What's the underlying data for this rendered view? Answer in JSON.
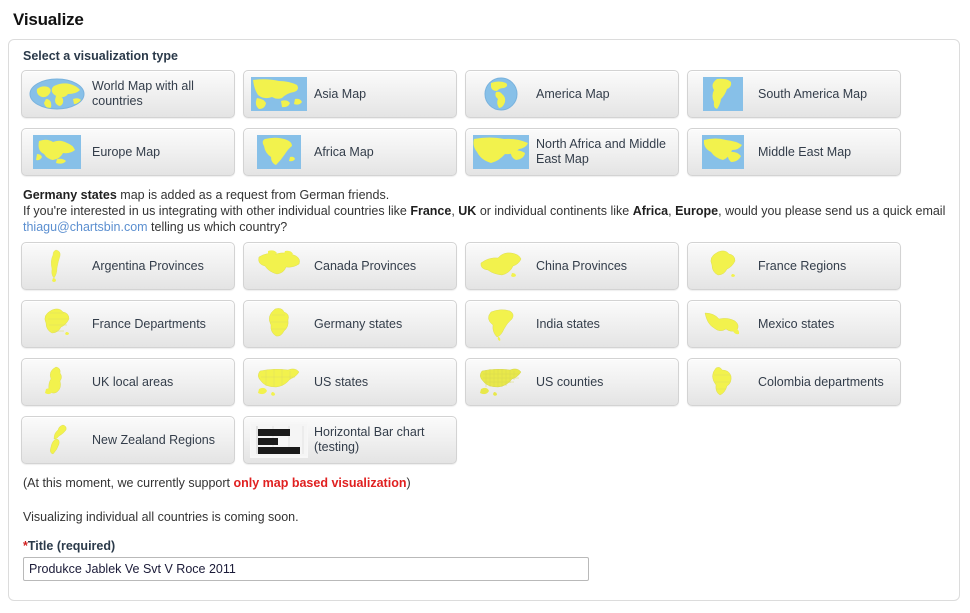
{
  "page": {
    "title": "Visualize"
  },
  "section": {
    "heading": "Select a visualization type"
  },
  "maps_row1": [
    {
      "label": "World Map with all countries",
      "icon": "world-map-thumb"
    },
    {
      "label": "Asia Map",
      "icon": "asia-map-thumb"
    },
    {
      "label": "America Map",
      "icon": "america-map-thumb"
    },
    {
      "label": "South America Map",
      "icon": "south-america-map-thumb"
    }
  ],
  "maps_row2": [
    {
      "label": "Europe Map",
      "icon": "europe-map-thumb"
    },
    {
      "label": "Africa Map",
      "icon": "africa-map-thumb"
    },
    {
      "label": "North Africa and Middle East Map",
      "icon": "north-africa-middle-east-map-thumb"
    },
    {
      "label": "Middle East Map",
      "icon": "middle-east-map-thumb"
    }
  ],
  "note": {
    "line1_bold": "Germany states",
    "line1_rest": " map is added as a request from German friends.",
    "line2_a": "If you're interested in us integrating with other individual countries like ",
    "line2_b1": "France",
    "line2_c": ", ",
    "line2_b2": "UK",
    "line2_d": " or individual continents like ",
    "line2_b3": "Africa",
    "line2_e": ", ",
    "line2_b4": "Europe",
    "line2_f": ", would you please send us a quick email ",
    "email": "thiagu@chartsbin.com",
    "line2_g": " telling us which country?"
  },
  "regions": [
    {
      "label": "Argentina Provinces",
      "icon": "argentina-provinces-thumb"
    },
    {
      "label": "Canada Provinces",
      "icon": "canada-provinces-thumb"
    },
    {
      "label": "China Provinces",
      "icon": "china-provinces-thumb"
    },
    {
      "label": "France Regions",
      "icon": "france-regions-thumb"
    },
    {
      "label": "France Departments",
      "icon": "france-departments-thumb"
    },
    {
      "label": "Germany states",
      "icon": "germany-states-thumb"
    },
    {
      "label": "India states",
      "icon": "india-states-thumb"
    },
    {
      "label": "Mexico states",
      "icon": "mexico-states-thumb"
    },
    {
      "label": "UK local areas",
      "icon": "uk-local-areas-thumb"
    },
    {
      "label": "US states",
      "icon": "us-states-thumb"
    },
    {
      "label": "US counties",
      "icon": "us-counties-thumb"
    },
    {
      "label": "Colombia departments",
      "icon": "colombia-departments-thumb"
    },
    {
      "label": "New Zealand Regions",
      "icon": "new-zealand-regions-thumb"
    },
    {
      "label": "Horizontal Bar chart (testing)",
      "icon": "horizontal-bar-chart-thumb"
    }
  ],
  "support": {
    "prefix": "(At this moment, we currently support ",
    "highlight": "only map based visualization",
    "suffix": ")"
  },
  "coming_soon": "Visualizing individual all countries is coming soon.",
  "title_field": {
    "star": "*",
    "label": "Title (required)",
    "value": "Produkce Jablek Ve Svt V Roce 2011",
    "placeholder": ""
  },
  "colors": {
    "map_land": "#f2f24d",
    "map_sea": "#87c0e8",
    "link": "#5b8fd0",
    "required": "#d02020",
    "alert": "#e02020"
  }
}
